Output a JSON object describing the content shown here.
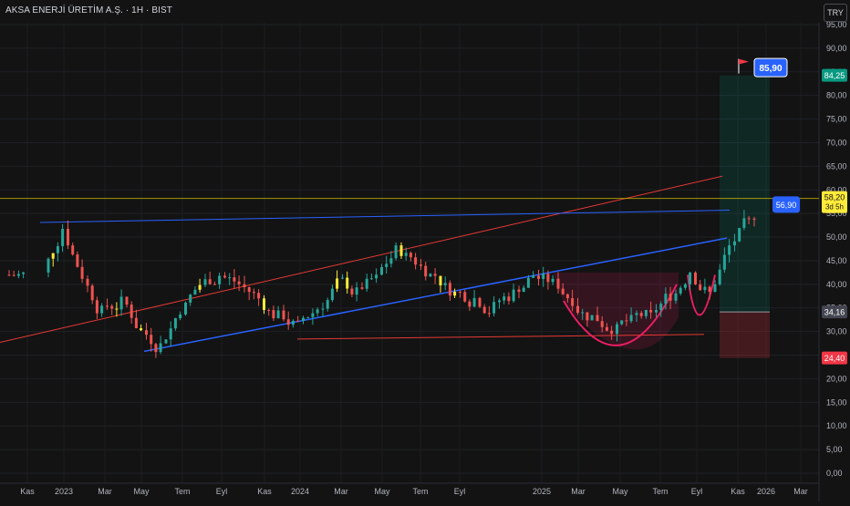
{
  "header": {
    "title": "AKSA ENERJİ ÜRETİM A.Ş. · 1H · BIST",
    "currency_button": "TRY"
  },
  "colors": {
    "background": "#131313",
    "up": "#26a69a",
    "down": "#ef5350",
    "highlight": "#ffeb3b",
    "trend_blue": "#2962ff",
    "trend_red": "#e53935",
    "cup_pink": "#e91e63",
    "target_green": "#089981",
    "stop_red": "#f23645"
  },
  "chart_data": {
    "type": "candlestick",
    "ylim": [
      0,
      95
    ],
    "y_ticks": [
      "0,00",
      "5,00",
      "10,00",
      "15,00",
      "20,00",
      "25,00",
      "30,00",
      "35,00",
      "40,00",
      "45,00",
      "50,00",
      "55,00",
      "60,00",
      "65,00",
      "70,00",
      "75,00",
      "80,00",
      "85,00",
      "90,00",
      "95,00"
    ],
    "x_ticks": [
      "Kas",
      "2023",
      "Mar",
      "May",
      "Tem",
      "Eyl",
      "Kas",
      "2024",
      "Mar",
      "May",
      "Tem",
      "Eyl",
      "2025",
      "Mar",
      "May",
      "Tem",
      "Eyl",
      "Kas",
      "2026",
      "Mar"
    ],
    "series_close_approx": [
      [
        "2022-10",
        42
      ],
      [
        "2022-12",
        52
      ],
      [
        "2023-01",
        42
      ],
      [
        "2023-02",
        34
      ],
      [
        "2023-03",
        36
      ],
      [
        "2023-04",
        30
      ],
      [
        "2023-05",
        27
      ],
      [
        "2023-06",
        35
      ],
      [
        "2023-07",
        40
      ],
      [
        "2023-08",
        42
      ],
      [
        "2023-09",
        40
      ],
      [
        "2023-10",
        37
      ],
      [
        "2023-11",
        33
      ],
      [
        "2023-12",
        31
      ],
      [
        "2024-01",
        35
      ],
      [
        "2024-02",
        40
      ],
      [
        "2024-03",
        38
      ],
      [
        "2024-04",
        41
      ],
      [
        "2024-05",
        47
      ],
      [
        "2024-06",
        45
      ],
      [
        "2024-07",
        42
      ],
      [
        "2024-08",
        38
      ],
      [
        "2024-09",
        37
      ],
      [
        "2024-10",
        35
      ],
      [
        "2024-11",
        38
      ],
      [
        "2024-12",
        42
      ],
      [
        "2025-01",
        40
      ],
      [
        "2025-02",
        37
      ],
      [
        "2025-03",
        33
      ],
      [
        "2025-04",
        31
      ],
      [
        "2025-05",
        32
      ],
      [
        "2025-06",
        33
      ],
      [
        "2025-07",
        38
      ],
      [
        "2025-08",
        43
      ],
      [
        "2025-09",
        38
      ],
      [
        "2025-10",
        48
      ],
      [
        "2025-11",
        53
      ],
      [
        "2025-12",
        58.2
      ]
    ],
    "price_labels": {
      "target": "85,90",
      "current_bubble": "56,90",
      "last_price": "58,20",
      "countdown": "3d 5h",
      "tp_level": "84,25",
      "entry_level": "34,16",
      "stop_level": "24,40"
    },
    "levels": {
      "target": 85.9,
      "current_bubble": 56.9,
      "last_price": 58.2,
      "tp": 84.25,
      "entry": 34.16,
      "stop": 24.4
    }
  }
}
